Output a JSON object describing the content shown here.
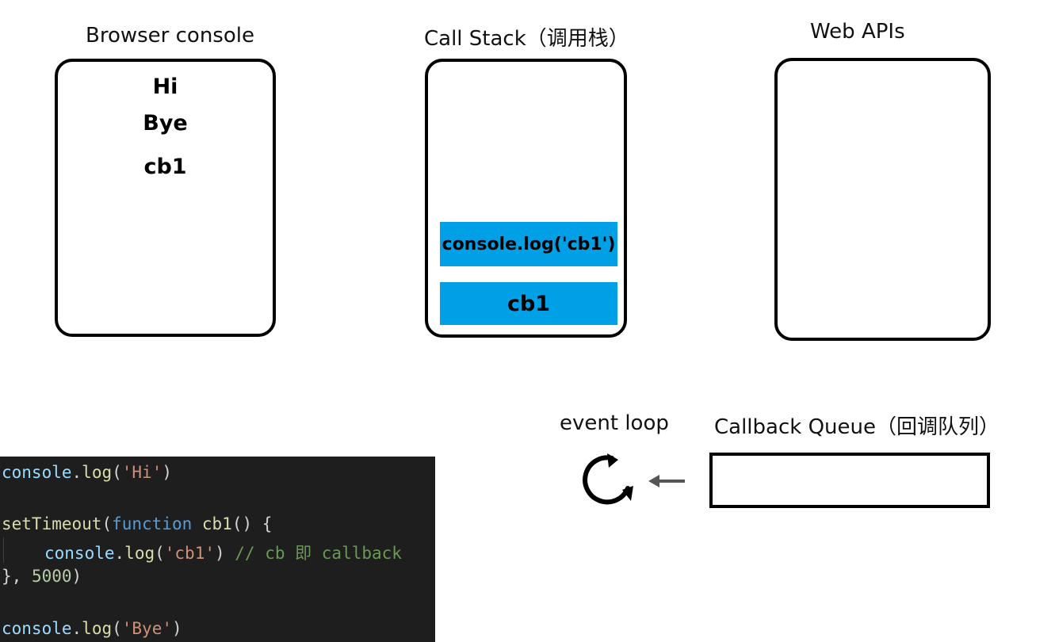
{
  "titles": {
    "console": "Browser console",
    "stack": "Call Stack（调用栈）",
    "webapis": "Web APIs",
    "eventloop": "event loop",
    "queue": "Callback Queue（回调队列）"
  },
  "console_lines": [
    "Hi",
    "Bye",
    "cb1"
  ],
  "stack_frames": [
    "console.log('cb1')",
    "cb1"
  ],
  "colors": {
    "stack_frame": "#00a0e6",
    "code_bg": "#1e1e1e"
  },
  "icons": {
    "loop": "refresh-icon",
    "arrow": "arrow-left-icon"
  },
  "code": {
    "l1": {
      "obj": "console",
      "dot": ".",
      "fn": "log",
      "open": "(",
      "str": "'Hi'",
      "close": ")"
    },
    "l2": {
      "fn": "setTimeout",
      "open": "(",
      "kw": "function",
      "name": " cb1",
      "rest": "() {"
    },
    "l3": {
      "obj": "console",
      "dot": ".",
      "fn": "log",
      "open": "(",
      "str": "'cb1'",
      "close": ")",
      "cmt": " // cb 即 callback"
    },
    "l4": {
      "pre": "}, ",
      "num": "5000",
      "close": ")"
    },
    "l5": {
      "obj": "console",
      "dot": ".",
      "fn": "log",
      "open": "(",
      "str": "'Bye'",
      "close": ")"
    }
  }
}
